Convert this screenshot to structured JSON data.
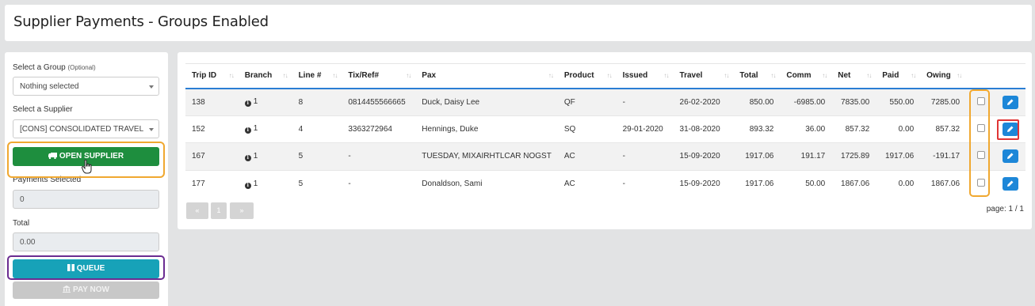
{
  "header": {
    "title": "Supplier Payments - Groups Enabled"
  },
  "sidebar": {
    "group_label": "Select a Group",
    "group_optional": "(Optional)",
    "group_value": "Nothing selected",
    "supplier_label": "Select a Supplier",
    "supplier_value": "[CONS] CONSOLIDATED TRAVEL",
    "open_supplier_label": "OPEN SUPPLIER",
    "payments_selected_label": "Payments Selected",
    "payments_selected_value": "0",
    "total_label": "Total",
    "total_value": "0.00",
    "queue_label": "QUEUE",
    "pay_now_label": "PAY NOW"
  },
  "table": {
    "columns": [
      "Trip ID",
      "Branch",
      "Line #",
      "Tix/Ref#",
      "Pax",
      "Product",
      "Issued",
      "Travel",
      "Total",
      "Comm",
      "Net",
      "Paid",
      "Owing"
    ],
    "rows": [
      {
        "trip_id": "138",
        "branch": "1",
        "line": "8",
        "tix": "0814455566665",
        "pax": "Duck, Daisy Lee",
        "product": "QF",
        "issued": "-",
        "travel": "26-02-2020",
        "total": "850.00",
        "comm": "-6985.00",
        "net": "7835.00",
        "paid": "550.00",
        "owing": "7285.00"
      },
      {
        "trip_id": "152",
        "branch": "1",
        "line": "4",
        "tix": "3363272964",
        "pax": "Hennings, Duke",
        "product": "SQ",
        "issued": "29-01-2020",
        "travel": "31-08-2020",
        "total": "893.32",
        "comm": "36.00",
        "net": "857.32",
        "paid": "0.00",
        "owing": "857.32"
      },
      {
        "trip_id": "167",
        "branch": "1",
        "line": "5",
        "tix": "-",
        "pax": "TUESDAY, MIXAIRHTLCAR NOGST",
        "product": "AC",
        "issued": "-",
        "travel": "15-09-2020",
        "total": "1917.06",
        "comm": "191.17",
        "net": "1725.89",
        "paid": "1917.06",
        "owing": "-191.17"
      },
      {
        "trip_id": "177",
        "branch": "1",
        "line": "5",
        "tix": "-",
        "pax": "Donaldson, Sami",
        "product": "AC",
        "issued": "-",
        "travel": "15-09-2020",
        "total": "1917.06",
        "comm": "50.00",
        "net": "1867.06",
        "paid": "0.00",
        "owing": "1867.06"
      }
    ]
  },
  "pagination": {
    "first": "«",
    "page": "1",
    "last": "»",
    "info": "page: 1 / 1"
  },
  "colors": {
    "primary": "#1d87d8",
    "green": "#1e8e3e",
    "teal": "#17a2b8",
    "highlight_orange": "#f0a830",
    "highlight_purple": "#6b2c91",
    "highlight_red": "#e03535"
  }
}
